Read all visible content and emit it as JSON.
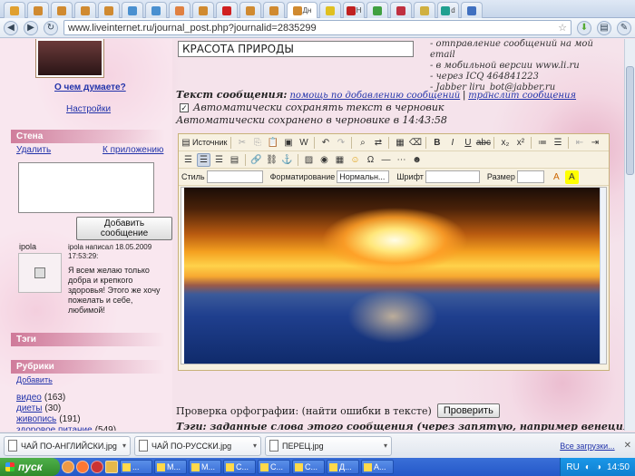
{
  "browser": {
    "tabs": [
      {
        "label": "",
        "color": "#e0a030"
      },
      {
        "label": "",
        "color": "#d08a30"
      },
      {
        "label": "",
        "color": "#d08a30"
      },
      {
        "label": "",
        "color": "#d08a30"
      },
      {
        "label": "",
        "color": "#d08a30"
      },
      {
        "label": "",
        "color": "#4a90d0"
      },
      {
        "label": "",
        "color": "#4a90d0"
      },
      {
        "label": "",
        "color": "#e08040"
      },
      {
        "label": "",
        "color": "#d08a30"
      },
      {
        "label": "",
        "color": "#d02020"
      },
      {
        "label": "",
        "color": "#d08a30"
      },
      {
        "label": "",
        "color": "#d08a30"
      },
      {
        "label": "Дн",
        "color": "#d08a30"
      },
      {
        "label": "",
        "color": "#e0c020"
      },
      {
        "label": "H",
        "color": "#c02020"
      },
      {
        "label": "",
        "color": "#40a040"
      },
      {
        "label": "",
        "color": "#c03040"
      },
      {
        "label": "",
        "color": "#d0b040"
      },
      {
        "label": "d",
        "color": "#20a090"
      },
      {
        "label": "",
        "color": "#4070c0"
      }
    ],
    "url": "www.liveinternet.ru/journal_post.php?journalid=2835299"
  },
  "sidebar": {
    "thinking_link": "О чем думаете?",
    "settings_link": "Настройки",
    "wall_title": "Стена",
    "delete_link": "Удалить",
    "app_link": "К приложению",
    "add_message_btn": "Добавить сообщение",
    "post_user": "ipola",
    "post_meta": "ipola написал 18.05.2009 17:53:29:",
    "post_text": "Я всем желаю только добра и крепкого здоровья! Этого же хочу пожелать и себе, любимой!",
    "tags_title": "Тэги",
    "rubrics_title": "Рубрики",
    "add_link": "Добавить",
    "rubrics": [
      {
        "name": "видео",
        "count": "(163)"
      },
      {
        "name": "диеты",
        "count": "(30)"
      },
      {
        "name": "живопись",
        "count": "(191)"
      },
      {
        "name": "здоровое питание",
        "count": "(549)"
      }
    ]
  },
  "content": {
    "post_title": "КРАСОТА ПРИРОДЫ",
    "contacts": [
      "- отправление сообщений на мой email",
      "- в мобильной версии www.li.ru",
      "- через ICQ 464841223",
      "- Jabber liru_bot@jabber.ru"
    ],
    "message_label": "Текст сообщения:",
    "help_link": "помощь по добавлению сообщений",
    "translit_link": "транслит сообщения",
    "autosave_label": "Автоматически сохранять текст в черновик",
    "autosaved_text": "Автоматически сохранено в черновике в 14:43:58",
    "spellcheck_label": "Проверка орфографии: (найти ошибки в тексте)",
    "check_btn": "Проверить",
    "tags_label_cut": "Тэги: заданные слова этого сообщения (через запятую, например венеция, шоколад"
  },
  "editor": {
    "source_btn": "Источник",
    "style_label": "Стиль",
    "format_label": "Форматирование",
    "format_value": "Нормальн...",
    "font_label": "Шрифт",
    "size_label": "Размер"
  },
  "downloads": [
    {
      "name": "ЧАЙ ПО-АНГЛИЙСКИ.jpg"
    },
    {
      "name": "ЧАЙ ПО-РУССКИ.jpg"
    },
    {
      "name": "ПЕРЕЦ.jpg"
    }
  ],
  "downloads_all": "Все загрузки...",
  "taskbar": {
    "start": "пуск",
    "buttons": [
      {
        "label": "..."
      },
      {
        "label": "М..."
      },
      {
        "label": "М..."
      },
      {
        "label": "С..."
      },
      {
        "label": "С..."
      },
      {
        "label": "С..."
      },
      {
        "label": "Д..."
      },
      {
        "label": "А..."
      }
    ],
    "lang": "RU",
    "clock": "14:50"
  }
}
